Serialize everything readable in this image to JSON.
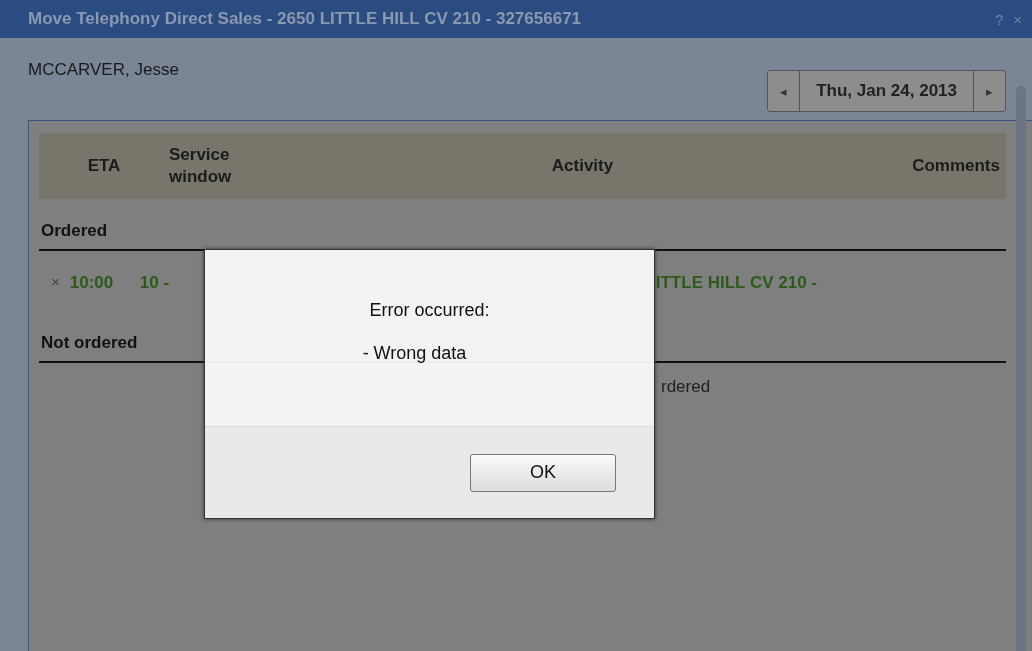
{
  "window": {
    "title": "Move Telephony Direct Sales - 2650 LITTLE HILL CV 210 - 327656671",
    "help": "?",
    "close": "×"
  },
  "technician": "MCCARVER, Jesse",
  "date_nav": {
    "prev": "◂",
    "date": "Thu, Jan 24, 2013",
    "next": "▸"
  },
  "table": {
    "columns": [
      "ETA",
      "Service\nwindow",
      "Activity",
      "Comments"
    ]
  },
  "groups": [
    {
      "title": "Ordered",
      "rows": [
        {
          "remove": "×",
          "eta": "10:00",
          "window": "10 -",
          "activity": "ITTLE HILL CV 210 -"
        }
      ]
    },
    {
      "title": "Not ordered",
      "drop_hint": "rdered"
    }
  ],
  "dialog": {
    "title": "Error occurred:",
    "message": "- Wrong data",
    "button": "OK"
  }
}
